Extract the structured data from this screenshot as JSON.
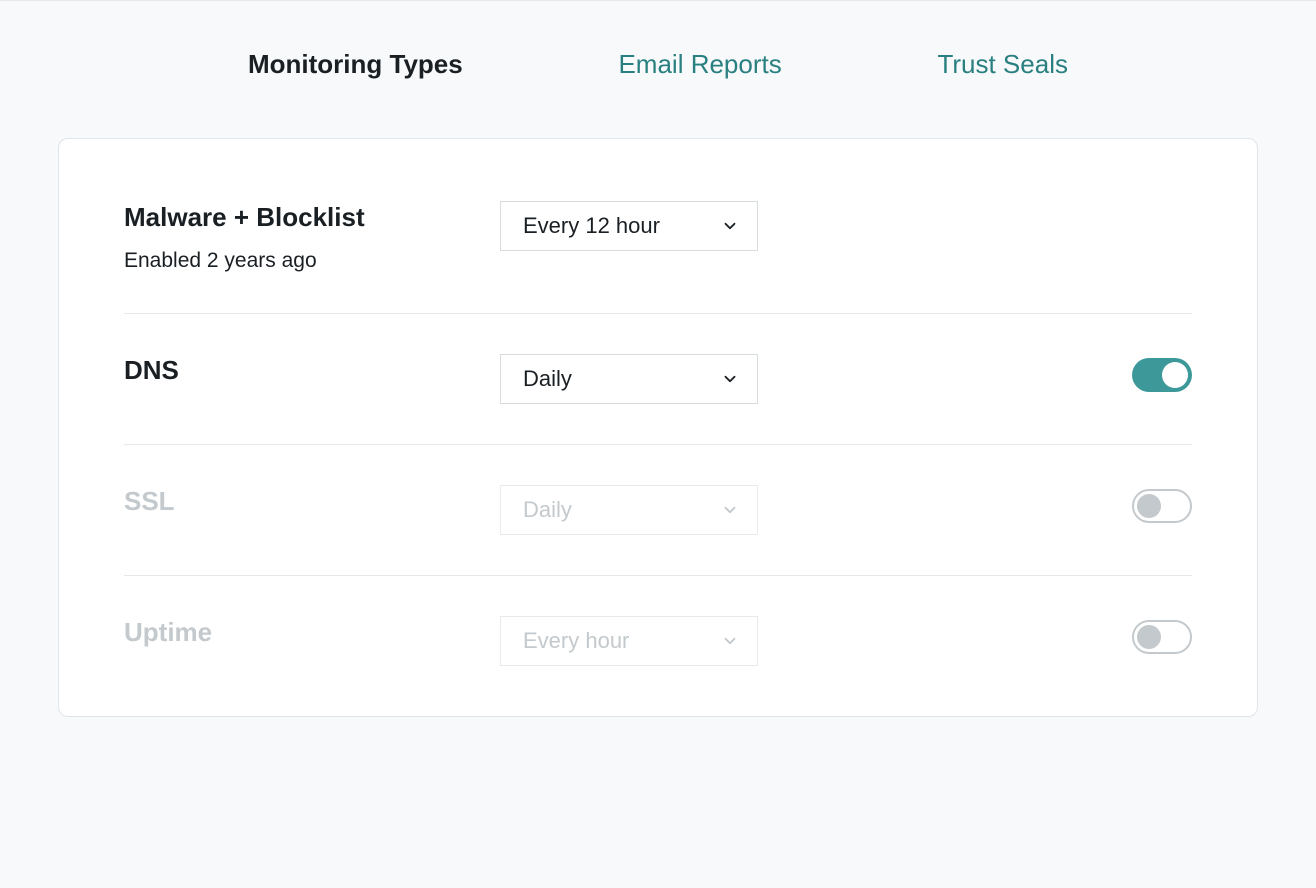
{
  "tabs": {
    "monitoring_types": "Monitoring Types",
    "email_reports": "Email Reports",
    "trust_seals": "Trust Seals"
  },
  "rows": {
    "malware": {
      "title": "Malware + Blocklist",
      "subtitle": "Enabled 2 years ago",
      "frequency": "Every 12 hour"
    },
    "dns": {
      "title": "DNS",
      "frequency": "Daily"
    },
    "ssl": {
      "title": "SSL",
      "frequency": "Daily"
    },
    "uptime": {
      "title": "Uptime",
      "frequency": "Every hour"
    }
  }
}
